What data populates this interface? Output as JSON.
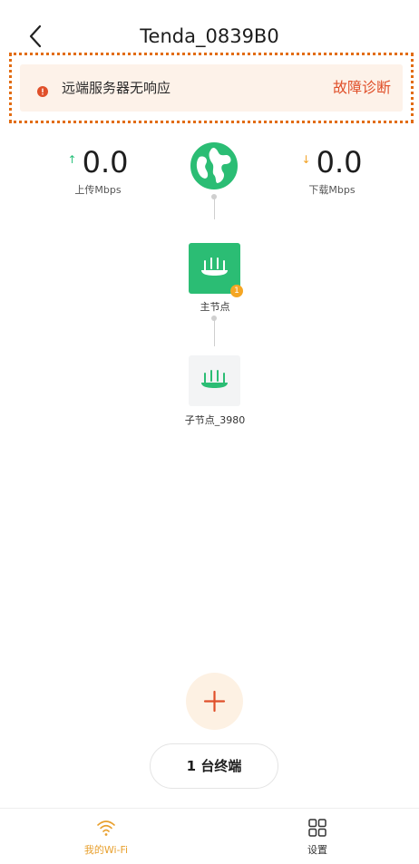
{
  "header": {
    "title": "Tenda_0839B0",
    "back_icon": "chevron-left-icon"
  },
  "alert": {
    "message": "远端服务器无响应",
    "action": "故障诊断",
    "icon": "error-dot-icon",
    "color": "#e0502a"
  },
  "speed": {
    "upload_value": "0.0",
    "upload_label": "上传Mbps",
    "download_value": "0.0",
    "download_label": "下载Mbps"
  },
  "topology": {
    "internet_icon": "globe-icon",
    "main_node_label": "主节点",
    "main_node_badge": "1",
    "sub_node_label": "子节点_3980"
  },
  "actions": {
    "add_icon": "plus-icon",
    "terminals_label": "1 台终端"
  },
  "tabbar": {
    "wifi_label": "我的Wi-Fi",
    "settings_label": "设置",
    "active_color": "#e8a02e"
  },
  "colors": {
    "brand_green": "#2bbd74",
    "accent_orange": "#f5a623"
  }
}
